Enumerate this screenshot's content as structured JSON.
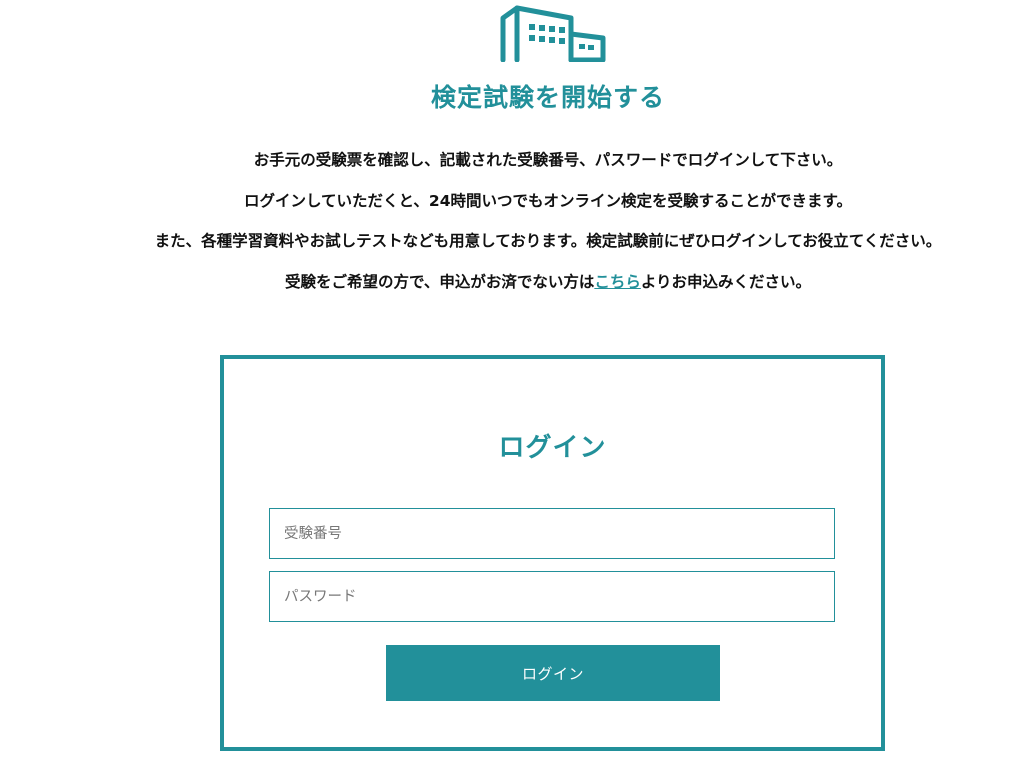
{
  "header": {
    "logo_icon": "building-icon",
    "title": "検定試験を開始する"
  },
  "intro": {
    "line1": "お手元の受験票を確認し、記載された受験番号、パスワードでログインして下さい。",
    "line2": "ログインしていただくと、24時間いつでもオンライン検定を受験することができます。",
    "line3": "また、各種学習資料やお試しテストなども用意しております。検定試験前にぜひログインしてお役立てください。",
    "line4_before": "受験をご希望の方で、申込がお済でない方は",
    "line4_link": "こちら",
    "line4_after": "よりお申込みください。"
  },
  "login": {
    "title": "ログイン",
    "id_placeholder": "受験番号",
    "password_placeholder": "パスワード",
    "button_label": "ログイン"
  },
  "colors": {
    "accent": "#22909a"
  }
}
